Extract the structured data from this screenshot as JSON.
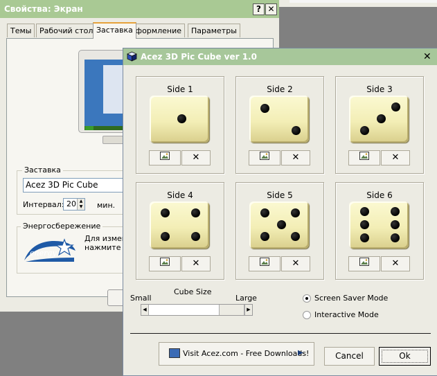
{
  "background_dialog": {
    "title": "Свойства: Экран",
    "help_glyph": "?",
    "close_glyph": "✕",
    "tabs": [
      {
        "label": "Темы"
      },
      {
        "label": "Рабочий стол"
      },
      {
        "label": "Заставка"
      },
      {
        "label": "Оформление"
      },
      {
        "label": "Параметры"
      }
    ],
    "active_tab": "Заставка",
    "screensaver_group": "Заставка",
    "screensaver_selected": "Acez 3D Pic Cube",
    "interval_label": "Интервал:",
    "interval_value": "20",
    "interval_unit": "мин.",
    "energy_group": "Энергосбережение",
    "energy_text_1": "Для измен",
    "energy_text_2": "нажмите к",
    "energy_logo_text": "energy"
  },
  "main_dialog": {
    "title": "Acez 3D Pic Cube ver 1.0",
    "close_glyph": "✕",
    "sides": [
      {
        "label": "Side 1",
        "pips": 1
      },
      {
        "label": "Side 2",
        "pips": 2
      },
      {
        "label": "Side 3",
        "pips": 3
      },
      {
        "label": "Side 4",
        "pips": 4
      },
      {
        "label": "Side 5",
        "pips": 5
      },
      {
        "label": "Side 6",
        "pips": 6
      }
    ],
    "side_buttons": {
      "picture_icon": "picture-icon",
      "remove_glyph": "✕"
    },
    "cube_size": {
      "label": "Cube Size",
      "min_label": "Small",
      "max_label": "Large"
    },
    "modes": [
      {
        "label": "Screen Saver Mode",
        "selected": true
      },
      {
        "label": "Interactive Mode",
        "selected": false
      }
    ],
    "visit_button": "Visit Acez.com - Free Downloads!",
    "cancel_button": "Cancel",
    "ok_button": "Ok"
  },
  "colors": {
    "title_bar": "#a7c79a",
    "face": "#ecebe3",
    "die_face": "#f3eeb6"
  }
}
